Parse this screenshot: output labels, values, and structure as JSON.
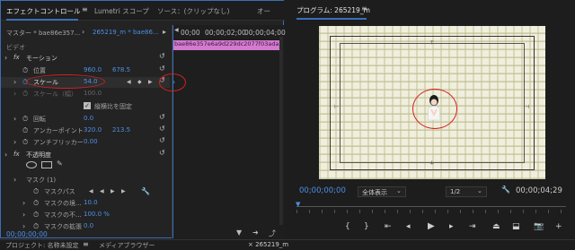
{
  "effect_controls": {
    "tabs": [
      {
        "label": "エフェクトコントロール"
      },
      {
        "label": "Lumetri スコープ"
      },
      {
        "label": "ソース：(クリップなし)"
      },
      {
        "label": "オー"
      }
    ],
    "master_label": "マスター * bae86e357...",
    "sequence_label": "265219_m * bae86...",
    "timecodes": [
      "00;00",
      "00;00;02;00",
      "00;00;04;00"
    ],
    "clip_name": "bae86e357e6a9d229dc2077f03ada50",
    "video_header": "ビデオ",
    "motion": {
      "fx": "fx",
      "label": "モーション",
      "position_label": "位置",
      "position_x": "960.0",
      "position_y": "678.5",
      "scale_label": "スケール",
      "scale_value": "54.0",
      "scale_width_label": "スケール（幅）",
      "scale_width_value": "100.0",
      "uniform_scale_label": "縦横比を固定",
      "rotation_label": "回転",
      "rotation_value": "0.0",
      "anchor_label": "アンカーポイント",
      "anchor_x": "320.0",
      "anchor_y": "213.5",
      "antiflicker_label": "アンチフリッカー",
      "antiflicker_value": "0.00"
    },
    "opacity": {
      "fx": "fx",
      "label": "不透明度",
      "mask_label": "マスク (1)",
      "mask_path_label": "マスクパス",
      "mask_feather_label": "マスクの境...",
      "mask_feather_value": "10.0",
      "mask_opacity_label": "マスクの不...",
      "mask_opacity_value": "100.0 %",
      "mask_expansion_label": "マスクの拡張",
      "mask_expansion_value": "0.0"
    },
    "current_time": "00;00;00;00"
  },
  "program_monitor": {
    "title": "プログラム: 265219_m",
    "timecode": "00;00;00;00",
    "zoom": "全体表示",
    "resolution": "1/2",
    "duration": "00;00;04;29"
  },
  "bottom_tabs": [
    {
      "label": "プロジェクト: 名称未設定"
    },
    {
      "label": "メディアブラウザー"
    },
    {
      "label": "× 265219_m"
    }
  ],
  "colors": {
    "accent_blue": "#4d8fe6",
    "annotation_red": "#d42020",
    "clip_pink": "#d47ad0"
  }
}
